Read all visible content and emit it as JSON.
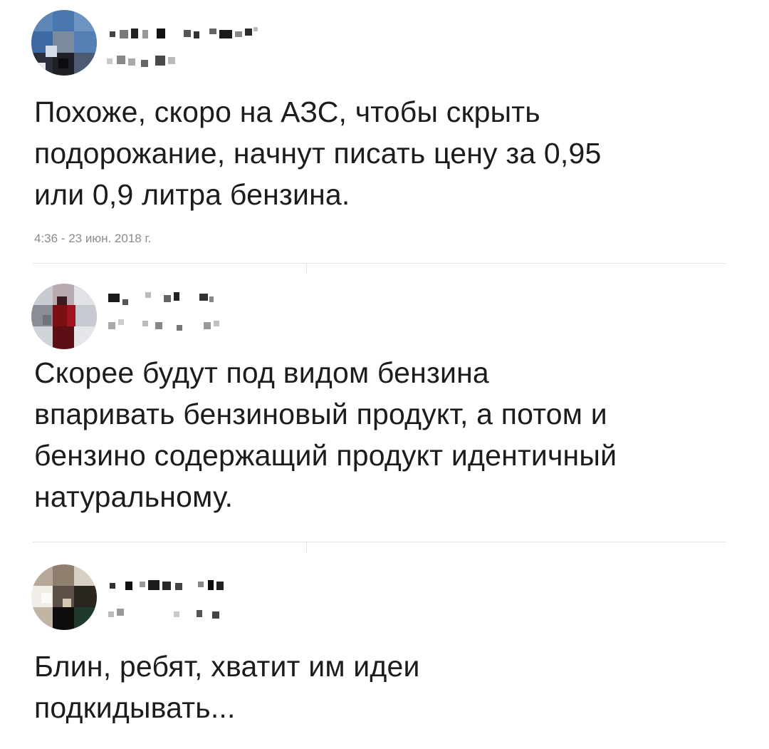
{
  "tweets": [
    {
      "author_name": "",
      "author_handle": "",
      "text": "Похоже, скоро на АЗС, чтобы скрыть\nподорожание, начнут писать цену за 0,95\nили 0,9 литра бензина.",
      "timestamp": "4:36 - 23 июн. 2018 г."
    },
    {
      "author_name": "",
      "author_handle": "",
      "text": "Скорее будут под видом бензина\nвпаривать бензиновый продукт, а потом и\nбензино содержащий продукт идентичный\nнатуральному."
    },
    {
      "author_name": "",
      "author_handle": "",
      "text": "Блин, ребят, хватит им идеи\nподкидывать..."
    }
  ],
  "colors": {
    "text": "#1c1c1c",
    "timestamp": "#8b8b8b",
    "divider": "#e4e4e4"
  },
  "icons": {
    "avatar_1": "blurred-avatar",
    "avatar_2": "blurred-avatar",
    "avatar_3": "blurred-avatar"
  }
}
